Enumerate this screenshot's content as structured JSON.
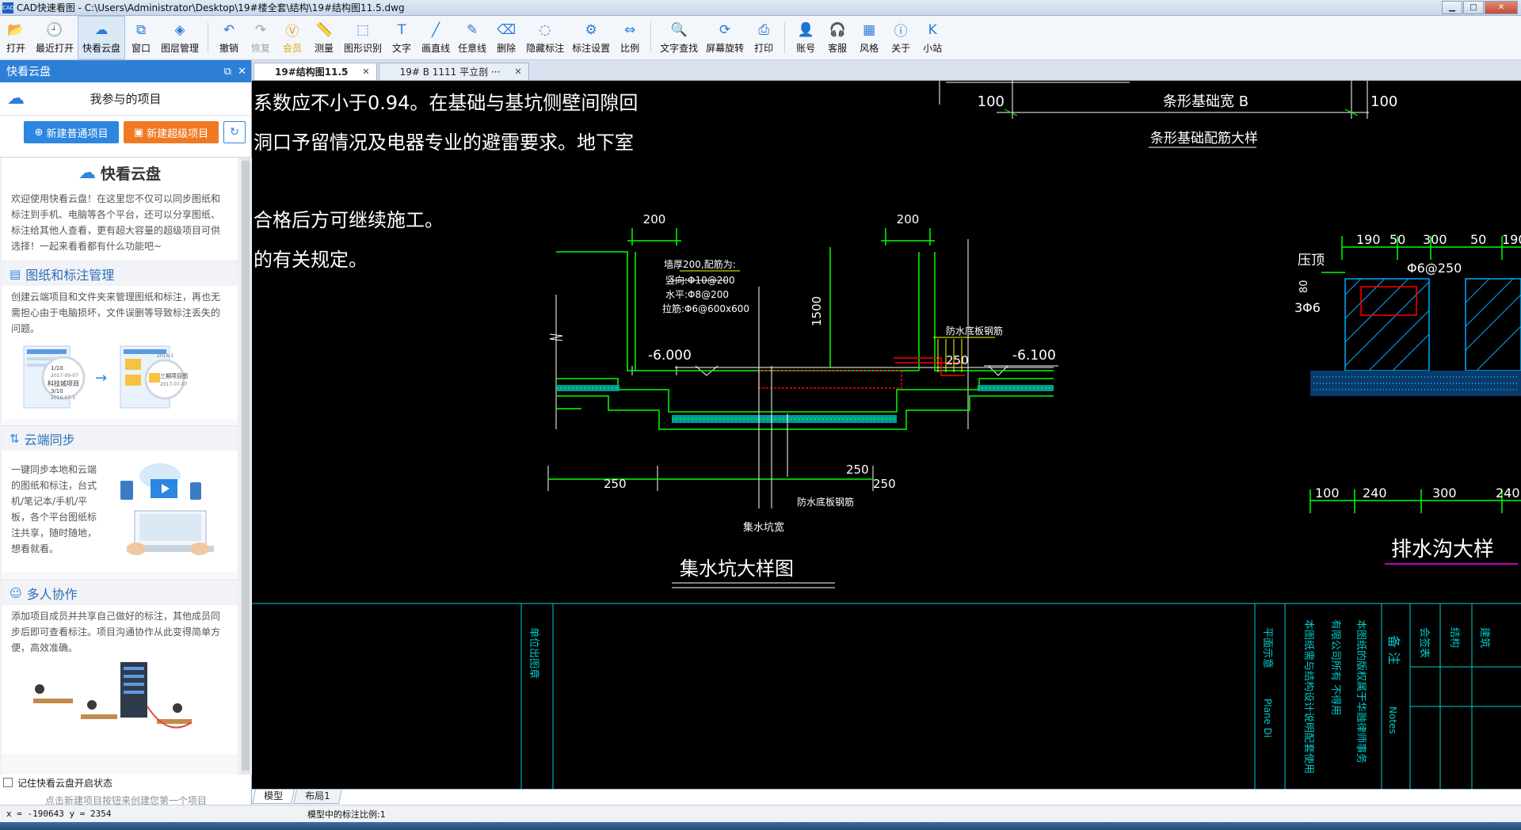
{
  "window": {
    "app_icon_text": "CAD",
    "title": "CAD快速看图 - C:\\Users\\Administrator\\Desktop\\19#楼全套\\结构\\19#结构图11.5.dwg",
    "minimize": "▁",
    "maximize": "□",
    "close": "✕"
  },
  "toolbar": [
    {
      "label": "打开",
      "icon": "folder-open"
    },
    {
      "label": "最近打开",
      "icon": "history"
    },
    {
      "label": "快看云盘",
      "icon": "cloud",
      "active": true
    },
    {
      "label": "窗口",
      "icon": "window"
    },
    {
      "label": "图层管理",
      "icon": "layers"
    },
    {
      "label": "撤销",
      "icon": "undo",
      "sep_before": true
    },
    {
      "label": "恢复",
      "icon": "redo",
      "disabled": true
    },
    {
      "label": "会员",
      "icon": "vip",
      "vip": true
    },
    {
      "label": "测量",
      "icon": "ruler"
    },
    {
      "label": "图形识别",
      "icon": "shape-recognize"
    },
    {
      "label": "文字",
      "icon": "text"
    },
    {
      "label": "画直线",
      "icon": "line"
    },
    {
      "label": "任意线",
      "icon": "pen"
    },
    {
      "label": "删除",
      "icon": "eraser"
    },
    {
      "label": "隐藏标注",
      "icon": "eye-off"
    },
    {
      "label": "标注设置",
      "icon": "annotation-settings"
    },
    {
      "label": "比例",
      "icon": "scale"
    },
    {
      "label": "文字查找",
      "icon": "text-search",
      "sep_before": true
    },
    {
      "label": "屏幕旋转",
      "icon": "rotate"
    },
    {
      "label": "打印",
      "icon": "printer"
    },
    {
      "label": "账号",
      "icon": "user",
      "sep_before": true
    },
    {
      "label": "客服",
      "icon": "headset"
    },
    {
      "label": "风格",
      "icon": "style"
    },
    {
      "label": "关于",
      "icon": "info"
    },
    {
      "label": "小站",
      "icon": "k-logo"
    }
  ],
  "side": {
    "header": "快看云盘",
    "subtitle": "我参与的项目",
    "btn_normal": "新建普通项目",
    "btn_super": "新建超级项目",
    "brand": "快看云盘",
    "intro": "欢迎使用快看云盘！在这里您不仅可以同步图纸和标注到手机、电脑等各个平台，还可以分享图纸、标注给其他人查看，更有超大容量的超级项目可供选择！一起来看看都有什么功能吧~",
    "sections": [
      {
        "title": "图纸和标注管理",
        "icon": "document-icon",
        "body": "创建云端项目和文件夹来管理图纸和标注，再也无需担心由于电脑损坏，文件误删等导致标注丢失的问题。",
        "ill": [
          "1/10",
          "2017-09-07",
          "科技城项目",
          "3/10",
          "2016-07-1",
          "2016-1",
          "三期项目图",
          "2017-07-07"
        ]
      },
      {
        "title": "云端同步",
        "icon": "cloud-sync-icon",
        "body": "一键同步本地和云端的图纸和标注，台式机/笔记本/手机/平板，各个平台图纸标注共享，随时随地，想看就看。"
      },
      {
        "title": "多人协作",
        "icon": "team-icon",
        "body": "添加项目成员并共享自己做好的标注，其他成员同步后即可查看标注。项目沟通协作从此变得简单方便，高效准确。"
      }
    ],
    "keep_open": "记住快看云盘开启状态",
    "hint": "点击新建项目按钮来创建您第一个项目"
  },
  "tabs": [
    {
      "label": "19#结构图11.5",
      "active": true
    },
    {
      "label": "19# B 1111 平立剖 ···",
      "active": false
    }
  ],
  "drawing": {
    "notes": [
      "系数应不小于0.94。在基础与基坑侧壁间隙回",
      "洞口予留情况及电器专业的避雷要求。地下室",
      "合格后方可继续施工。",
      "的有关规定。"
    ],
    "top_dims": [
      "100",
      "条形基础宽  B",
      "100"
    ],
    "top_caption": "条形基础配筋大样",
    "pit_title": "集水坑大样图",
    "pit_dims": [
      "200",
      "200",
      "1500",
      "250",
      "250",
      "250",
      "250"
    ],
    "pit_labels": [
      "墙厚200,配筋为:",
      "竖向:Φ10@200",
      "水平:Φ8@200",
      "拉筋:Φ6@600x600",
      "防水底板钢筋",
      "防水底板钢筋",
      "集水坑宽"
    ],
    "levels": [
      "-6.000",
      "-6.100"
    ],
    "ditch_title": "排水沟大样",
    "ditch_dims_top": [
      "190",
      "50",
      "300",
      "50",
      "190"
    ],
    "ditch_dims_bottom": [
      "100",
      "240",
      "300",
      "240"
    ],
    "ditch_labels": [
      "压顶",
      "Φ6@250",
      "80",
      "3Φ6"
    ],
    "titleblock": [
      "单位出图章",
      "平面示意",
      "本图纸需与结构设计说明配套使用",
      "有限公司所有  不得用",
      "本图纸的版权属于华融律师事务",
      "备 注",
      "会签表",
      "结构",
      "建筑"
    ],
    "titleblock_en": [
      "Plane Di",
      "Notes"
    ]
  },
  "layout_tabs": [
    {
      "label": "模型",
      "active": true
    },
    {
      "label": "布局1",
      "active": false
    }
  ],
  "status": {
    "coords": "x = -190643  y = 2354",
    "scale": "模型中的标注比例:1"
  },
  "colors": {
    "accent": "#2d86e0",
    "orange": "#f07a24",
    "cad_green": "#00ff00",
    "cad_white": "#ffffff",
    "cad_yellow": "#ffff00",
    "cad_red": "#ff0000",
    "cad_cyan": "#00ffff",
    "cad_magenta": "#ff00ff"
  }
}
